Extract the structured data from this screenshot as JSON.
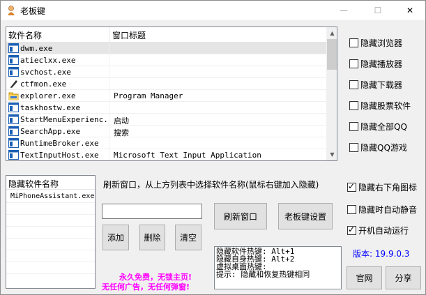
{
  "window": {
    "title": "老板键",
    "minimize_glyph": "—",
    "maximize_glyph": "☐",
    "close_glyph": "✕"
  },
  "process_list": {
    "columns": [
      "软件名称",
      "窗口标题"
    ],
    "rows": [
      {
        "name": "dwm.exe",
        "title": "",
        "icon": "window-icon",
        "selected": true
      },
      {
        "name": "atieclxx.exe",
        "title": "",
        "icon": "window-icon"
      },
      {
        "name": "svchost.exe",
        "title": "",
        "icon": "window-icon"
      },
      {
        "name": "ctfmon.exe",
        "title": "",
        "icon": "pen-icon"
      },
      {
        "name": "explorer.exe",
        "title": "Program Manager",
        "icon": "folder-icon"
      },
      {
        "name": "taskhostw.exe",
        "title": "",
        "icon": "window-icon"
      },
      {
        "name": "StartMenuExperienc...",
        "title": "启动",
        "icon": "window-icon"
      },
      {
        "name": "SearchApp.exe",
        "title": "搜索",
        "icon": "window-icon"
      },
      {
        "name": "RuntimeBroker.exe",
        "title": "",
        "icon": "window-icon"
      },
      {
        "name": "TextInputHost.exe",
        "title": "Microsoft Text Input Application",
        "icon": "window-icon"
      }
    ]
  },
  "right_options": [
    {
      "label": "隐藏浏览器",
      "checked": false
    },
    {
      "label": "隐藏播放器",
      "checked": false
    },
    {
      "label": "隐藏下载器",
      "checked": false
    },
    {
      "label": "隐藏股票软件",
      "checked": false
    },
    {
      "label": "隐藏全部QQ",
      "checked": false
    },
    {
      "label": "隐藏QQ游戏",
      "checked": false
    }
  ],
  "hidden_list": {
    "header": "隐藏软件名称",
    "items": [
      "MiPhoneAssistant.exe"
    ]
  },
  "instruction": "刷新窗口，从上方列表中选择软件名称(鼠标右键加入隐藏)",
  "input_value": "",
  "buttons": {
    "refresh": "刷新窗口",
    "settings": "老板键设置",
    "add": "添加",
    "delete": "删除",
    "clear": "清空",
    "website": "官网",
    "share": "分享"
  },
  "bottom_options": [
    {
      "label": "隐藏右下角图标",
      "checked": true
    },
    {
      "label": "隐藏时自动静音",
      "checked": false
    },
    {
      "label": "开机自动运行",
      "checked": true
    }
  ],
  "hotkeys_info": [
    "隐藏软件热键: Alt+1",
    "隐藏自身热键: Alt+2",
    "虚拟桌面热键:",
    "提示: 隐藏和恢复热键相同"
  ],
  "promo": [
    "永久免费，无锁主页!",
    "无任何广告，无任何弹窗!"
  ],
  "version": "版本: 19.9.0.3",
  "colors": {
    "promo": "#ff00ff",
    "version": "#0000ff"
  }
}
